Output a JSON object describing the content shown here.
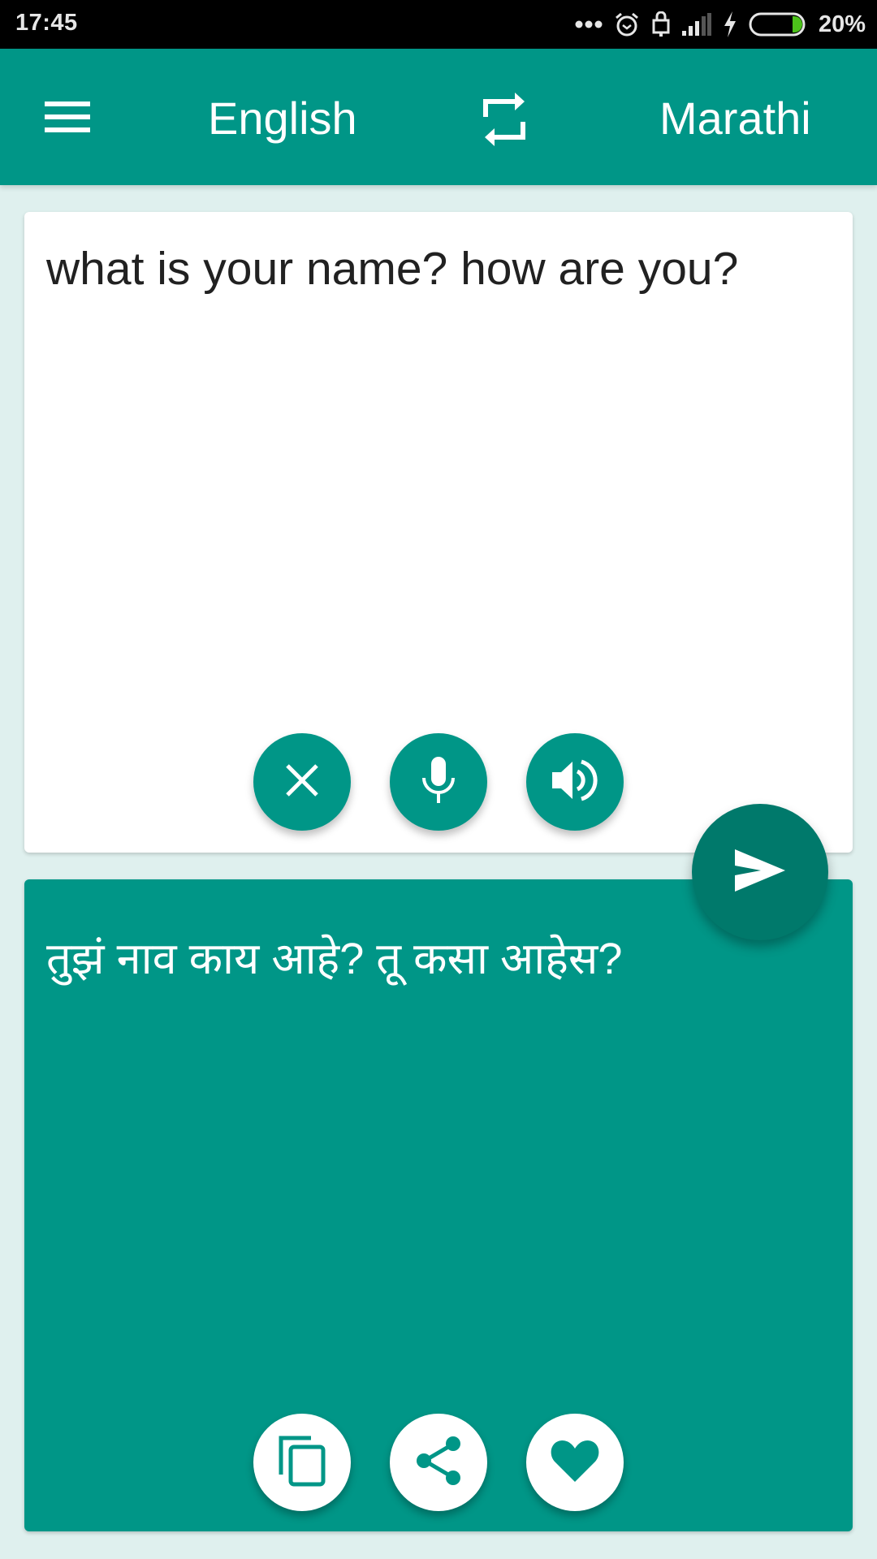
{
  "status_bar": {
    "time": "17:45",
    "battery_percent": "20%",
    "battery_level": 0.2,
    "icons": [
      "more-dots-icon",
      "alarm-icon",
      "lock-icon",
      "signal-icon",
      "charging-icon",
      "battery-icon"
    ]
  },
  "app_bar": {
    "menu_icon": "hamburger-menu-icon",
    "source_language": "English",
    "swap_icon": "swap-languages-icon",
    "target_language": "Marathi"
  },
  "input_card": {
    "text": "what is your name? how are you?",
    "buttons": [
      {
        "name": "clear",
        "icon": "close-icon"
      },
      {
        "name": "microphone",
        "icon": "microphone-icon"
      },
      {
        "name": "speak",
        "icon": "speaker-icon"
      }
    ]
  },
  "translate_button": {
    "icon": "send-icon"
  },
  "output_card": {
    "text": "तुझं नाव काय आहे? तू कसा आहेस?",
    "buttons": [
      {
        "name": "copy",
        "icon": "copy-icon"
      },
      {
        "name": "share",
        "icon": "share-icon"
      },
      {
        "name": "favorite",
        "icon": "heart-icon"
      }
    ]
  },
  "colors": {
    "primary": "#009687",
    "primary_dark": "#00796b",
    "background": "#dff0ee",
    "battery_fill": "#4cc21a"
  }
}
